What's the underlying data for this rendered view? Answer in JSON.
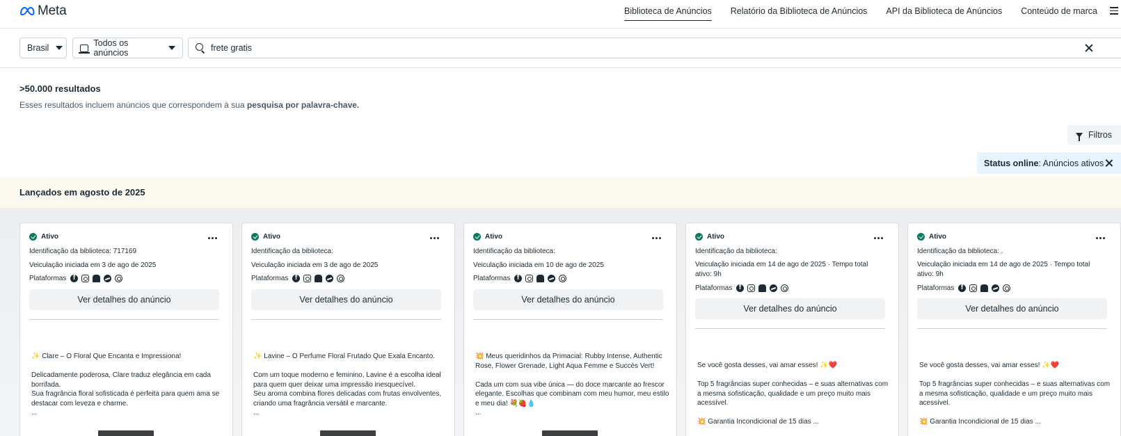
{
  "nav": {
    "logo_text": "Meta",
    "links": [
      {
        "label": "Biblioteca de Anúncios",
        "active": true
      },
      {
        "label": "Relatório da Biblioteca de Anúncios",
        "active": false
      },
      {
        "label": "API da Biblioteca de Anúncios",
        "active": false
      },
      {
        "label": "Conteúdo de marca",
        "active": false
      }
    ]
  },
  "search": {
    "country": "Brasil",
    "ad_type": "Todos os anúncios",
    "query": "frete gratis"
  },
  "results": {
    "count": ">50.000 resultados",
    "desc_prefix": "Esses resultados incluem anúncios que correspondem à sua ",
    "desc_bold": "pesquisa por palavra-chave.",
    "filters_label": "Filtros",
    "status_label": "Status online",
    "status_value": ": Anúncios ativos"
  },
  "section": {
    "title": "Lançados em agosto de 2025"
  },
  "colors": {
    "active_green": "#0d7a5f",
    "chip_blue": "#e7f3ff",
    "section_bg": "#fcfaf0"
  },
  "cards": [
    {
      "status": "Ativo",
      "library_id": "Identificação da biblioteca: 717169",
      "started": "Veiculação iniciada em 3 de ago de 2025",
      "platforms_label": "Plataformas",
      "details_button": "Ver detalhes do anúncio",
      "text": [
        "✨ Clare – O Floral Que Encanta e Impressiona!",
        "",
        "Delicadamente poderosa, Clare traduz elegância em cada borrifada.",
        " Sua fragrância floral sofisticada é perfeita para quem ama se destacar com leveza e charme.",
        "..."
      ]
    },
    {
      "status": "Ativo",
      "library_id": "Identificação da biblioteca:",
      "started": "Veiculação iniciada em 3 de ago de 2025",
      "platforms_label": "Plataformas",
      "details_button": "Ver detalhes do anúncio",
      "text": [
        "✨ Lavine – O Perfume Floral Frutado Que Exala Encanto.",
        "",
        "Com um toque moderno e feminino, Lavine é a escolha ideal para quem quer deixar uma impressão inesquecível.",
        " Seu aroma combina flores delicadas com frutas envolventes, criando uma fragrância versátil e marcante.",
        "..."
      ]
    },
    {
      "status": "Ativo",
      "library_id": "Identificação da biblioteca:",
      "started": "Veiculação iniciada em 10 de ago de 2025",
      "platforms_label": "Plataformas",
      "details_button": "Ver detalhes do anúncio",
      "text": [
        "💥 Meus queridinhos da Primacial: Rubby Intense, Authentic Rose, Flower Grenade, Light Aqua Femme e Succès Vert!",
        "",
        "Cada um com sua vibe única — do doce marcante ao frescor elegante. Escolhas que combinam com meu humor, meu estilo e meu dia! 💐🍓💧",
        "..."
      ]
    },
    {
      "status": "Ativo",
      "library_id": "Identificação da biblioteca:",
      "started": "Veiculação iniciada em 14 de ago de 2025 · Tempo total ativo: 9h",
      "platforms_label": "Plataformas",
      "details_button": "Ver detalhes do anúncio",
      "text": [
        "Se você gosta desses, vai amar esses! ✨❤️",
        "",
        "Top 5 fragrâncias super conhecidas – e suas alternativas com a mesma sofisticação, qualidade e um preço muito mais acessível.",
        "",
        "💥 Garantia Incondicional de 15 dias  ..."
      ]
    },
    {
      "status": "Ativo",
      "library_id": "Identificação da biblioteca: .",
      "started": "Veiculação iniciada em 14 de ago de 2025 · Tempo total ativo: 9h",
      "platforms_label": "Plataformas",
      "details_button": "Ver detalhes do anúncio",
      "text": [
        "Se você gosta desses, vai amar esses! ✨❤️",
        "",
        "Top 5 fragrâncias super conhecidas – e suas alternativas com a mesma sofisticação, qualidade e um preço muito mais acessível.",
        "",
        "💥 Garantia Incondicional de 15 dias  ..."
      ]
    }
  ]
}
